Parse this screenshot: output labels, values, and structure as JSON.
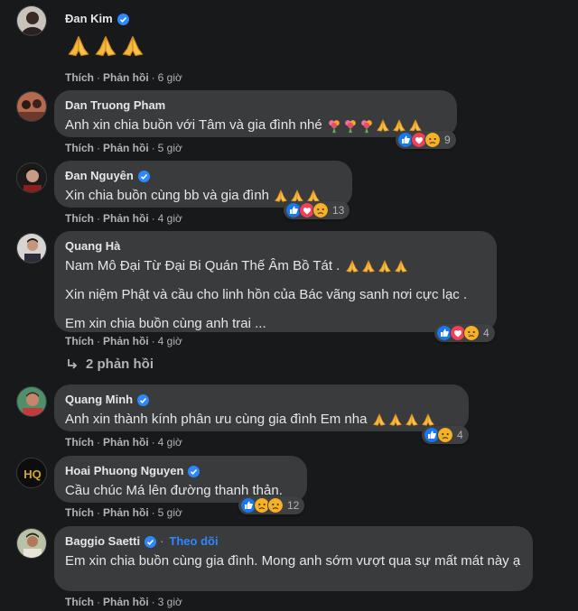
{
  "ui": {
    "like": "Thích",
    "reply": "Phản hồi",
    "follow": "Theo dõi"
  },
  "comments": [
    {
      "author": "Đan Kim",
      "verified": true,
      "text": "",
      "emoji": "🙏🙏🙏",
      "time": "6 giờ"
    },
    {
      "author": "Dan Truong Pham",
      "verified": false,
      "text": "Anh xin chia buồn với Tâm và gia đình nhé",
      "emoji": "💐💐💐🙏🙏🙏",
      "time": "5 giờ",
      "reaction_count": "9"
    },
    {
      "author": "Đan Nguyên",
      "verified": true,
      "text": "Xin chia buồn cùng bb và gia đình",
      "emoji": "🙏🙏🙏",
      "time": "4 giờ",
      "reaction_count": "13"
    },
    {
      "author": "Quang Hà",
      "verified": false,
      "paragraphs": [
        "Nam Mô Đại Từ Đại Bi Quán Thế Âm Bồ Tát .",
        "Xin niệm Phật và cầu cho linh hồn của Bác vãng sanh nơi cực lạc .",
        "Em xin chia buồn cùng anh trai ..."
      ],
      "emoji": "🙏🙏🙏🙏",
      "time": "4 giờ",
      "reaction_count": "4",
      "replies": "2 phản hồi"
    },
    {
      "author": "Quang Minh",
      "verified": true,
      "text": "Anh xin thành kính phân ưu cùng gia đình Em nha",
      "emoji": "🙏🙏🙏🙏",
      "time": "4 giờ",
      "reaction_count": "4"
    },
    {
      "author": "Hoai Phuong Nguyen",
      "verified": true,
      "text": "Cầu chúc Má lên đường thanh thản.",
      "time": "5 giờ",
      "reaction_count": "12"
    },
    {
      "author": "Baggio Saetti",
      "verified": true,
      "follow": true,
      "text": "Em xin chia buồn cùng gia đình. Mong anh sớm vượt qua sự mất mát này ạ",
      "time": "3 giờ"
    }
  ],
  "colors": {
    "background": "#18191a",
    "bubble": "#3a3b3c",
    "text": "#e4e6eb",
    "muted": "#b0b3b8",
    "accent": "#2d88ff"
  },
  "icons": {
    "like": "like-reaction-icon",
    "love": "love-reaction-icon",
    "sad": "sad-reaction-icon",
    "reply_arrow": "reply-arrow-icon"
  }
}
